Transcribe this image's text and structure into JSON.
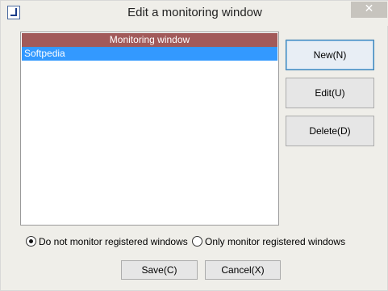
{
  "window": {
    "title": "Edit a monitoring window",
    "app_icon": "app-window-icon",
    "close_glyph": "✕"
  },
  "list": {
    "header": "Monitoring window",
    "rows": [
      "Softpedia"
    ],
    "selected_index": 0
  },
  "buttons": {
    "new_label": "New(N)",
    "edit_label": "Edit(U)",
    "delete_label": "Delete(D)",
    "save_label": "Save(C)",
    "cancel_label": "Cancel(X)"
  },
  "options": {
    "do_not_monitor_label": "Do not monitor registered windows",
    "only_monitor_label": "Only monitor registered windows",
    "selected": "do_not_monitor"
  },
  "colors": {
    "list_header_bg": "#a25a5a",
    "selection_bg": "#3399ff"
  }
}
